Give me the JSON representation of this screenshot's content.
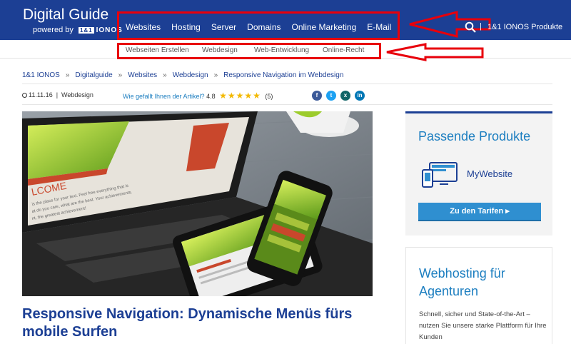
{
  "header": {
    "brand_title": "Digital Guide",
    "brand_sub": "powered by",
    "logo_box": "1&1",
    "logo_text": "IONOS",
    "nav": [
      "Websites",
      "Hosting",
      "Server",
      "Domains",
      "Online Marketing",
      "E-Mail"
    ],
    "separator": "|",
    "products_link": "1&1 IONOS Produkte"
  },
  "subnav": [
    "Webseiten Erstellen",
    "Webdesign",
    "Web-Entwicklung",
    "Online-Recht"
  ],
  "breadcrumb": {
    "items": [
      "1&1 IONOS",
      "Digitalguide",
      "Websites",
      "Webdesign",
      "Responsive Navigation im Webdesign"
    ],
    "separator": "»"
  },
  "meta": {
    "date": "11.11.16",
    "category": "Webdesign",
    "rating_question": "Wie gefallt Ihnen der Artikel?",
    "rating_value": "4.8",
    "stars": "★★★★★",
    "rating_count": "(5)"
  },
  "social": [
    {
      "icon": "facebook-icon",
      "glyph": "f",
      "color": "#3b5998"
    },
    {
      "icon": "twitter-icon",
      "glyph": "t",
      "color": "#1da1f2"
    },
    {
      "icon": "xing-icon",
      "glyph": "x",
      "color": "#126567"
    },
    {
      "icon": "linkedin-icon",
      "glyph": "in",
      "color": "#0077b5"
    }
  ],
  "article": {
    "title": "Responsive Navigation: Dynamische Menüs fürs mobile Surfen"
  },
  "sidebar": {
    "card1_title": "Passende Produkte",
    "product_name": "MyWebsite",
    "button_label": "Zu den Tarifen ▸",
    "card2_title": "Webhosting für Agenturen",
    "card2_text": "Schnell, sicher und State-of-the-Art – nutzen Sie unsere starke Plattform für Ihre Kunden"
  },
  "colors": {
    "brand_blue": "#1c3f94",
    "accent_blue": "#1c7ec0",
    "annotation_red": "#e8000b",
    "star_gold": "#f3b900"
  }
}
